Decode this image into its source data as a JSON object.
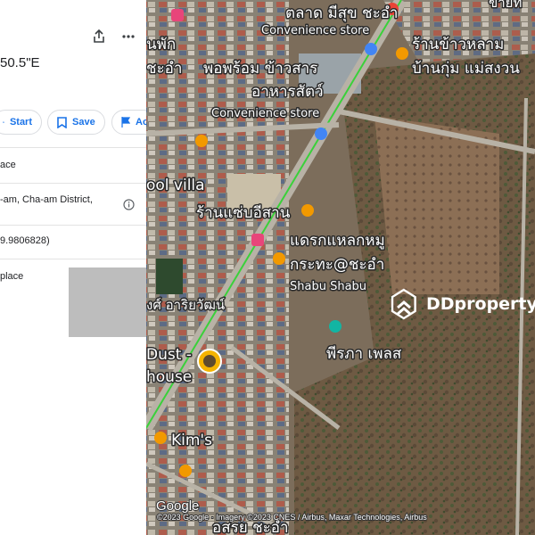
{
  "panel": {
    "coords_text": "50.5\"E",
    "actions": [
      {
        "label": "Start",
        "icon": "navigation-arrow-icon"
      },
      {
        "label": "Save",
        "icon": "bookmark-icon"
      },
      {
        "label": "Ac",
        "icon": "flag-icon"
      }
    ],
    "rows": [
      {
        "text": "ace"
      },
      {
        "text": "-am, Cha-am District,"
      },
      {
        "text": "9.9806828)"
      },
      {
        "text": "place"
      }
    ],
    "info_icon": "info-icon",
    "share_icon": "share-icon",
    "more_icon": "more-vertical-icon"
  },
  "map": {
    "labels": [
      {
        "id": "l1",
        "text": "ตลาด มีสุข ชะอำ"
      },
      {
        "id": "l2",
        "text": "Convenience store"
      },
      {
        "id": "l3",
        "text": "นพัก"
      },
      {
        "id": "l4",
        "text": "ร้านข้าวหลาม"
      },
      {
        "id": "l5",
        "text": "บ้านกุ่ม แม่สงวน"
      },
      {
        "id": "l6",
        "text": "ชะอำ"
      },
      {
        "id": "l7",
        "text": "พอพร้อม ข้าวสาร"
      },
      {
        "id": "l8",
        "text": "อาหารสัตว์"
      },
      {
        "id": "l9",
        "text": "Convenience store"
      },
      {
        "id": "l10",
        "text": "ool villa"
      },
      {
        "id": "l11",
        "text": "ร้านแซ่บอีสาน"
      },
      {
        "id": "l12",
        "text": "แดรกแหลกหมู"
      },
      {
        "id": "l13",
        "text": "กระทะ@ชะอำ"
      },
      {
        "id": "l14",
        "text": "Shabu Shabu"
      },
      {
        "id": "l15",
        "text": "งศ์ อาริยวัฒน์"
      },
      {
        "id": "l16",
        "text": "พีรภา เพลส"
      },
      {
        "id": "l17",
        "text": "Dust -"
      },
      {
        "id": "l18",
        "text": "house"
      },
      {
        "id": "l19",
        "text": "Kim's"
      },
      {
        "id": "l20",
        "text": "อสรย  ชะอำ"
      },
      {
        "id": "l21",
        "text": "ขายท"
      }
    ],
    "watermark": "DDproperty",
    "google_logo": "Google",
    "attribution": "©2023 Google · Imagery ©2023 CNES / Airbus, Maxar Technologies, Airbus",
    "colors": {
      "road_highlight": "#3ad13a",
      "pin_orange": "#f29900",
      "pin_blue": "#4285f4",
      "pin_pink": "#e8457a",
      "pin_red": "#ea4335",
      "pin_teal": "#12b5a3"
    }
  }
}
